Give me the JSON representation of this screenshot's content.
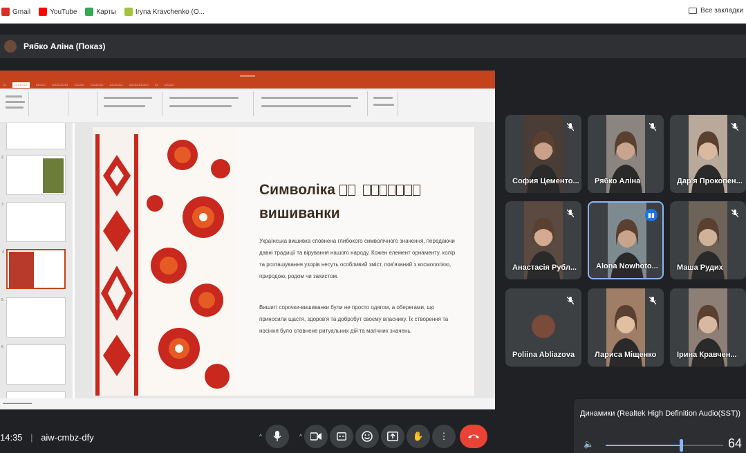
{
  "bookmarks": [
    {
      "label": "Gmail",
      "color": "#d93025"
    },
    {
      "label": "YouTube",
      "color": "#ff0000"
    },
    {
      "label": "Карты",
      "color": "#34a853"
    },
    {
      "label": "Iryna Kravchenko (О...",
      "color": "#a6c23a"
    }
  ],
  "all_bookmarks": "Все закладки",
  "presenter": "Рябко Аліна (Показ)",
  "slide": {
    "title_a": "Символіка",
    "title_b": "вишиванки",
    "para1": "Українська вишивка сповнена глибокого символічного значення, передаючи давні традиції та вірування нашого народу. Кожен елемент орнаменту, колір та розташування узорів несуть особливий зміст, пов'язаний з космологією, природою, родом чи захистом.",
    "para2": "Вишиті сорочки-вишиванки були не просто одягом, а оберегами, що приносили щастя, здоров'я та добробут своєму власнику. Їх створення та носіння було сповнене ритуальних дій та магічних значень."
  },
  "participants": [
    {
      "name": "София Цементо...",
      "muted": true,
      "bg": "#4a3d35",
      "skin": "#caa08a"
    },
    {
      "name": "Рябко Аліна",
      "muted": true,
      "bg": "#8a8580",
      "skin": "#c9a58f"
    },
    {
      "name": "Дар'я Прокопен...",
      "muted": true,
      "bg": "#b8a99a",
      "skin": "#d9b9a0"
    },
    {
      "name": "Анастасія Рубл...",
      "muted": true,
      "bg": "#5a4a42",
      "skin": "#d3ab92"
    },
    {
      "name": "Alona Nowhoto...",
      "muted": false,
      "bg": "#7d8a8f",
      "skin": "#c8a58a",
      "active": true
    },
    {
      "name": "Маша Рудих",
      "muted": true,
      "bg": "#6d6358",
      "skin": "#d0b29b"
    },
    {
      "name": "Poliina Abliazova",
      "muted": true,
      "bg": "#3c4043",
      "skin": "#7a4a3a"
    },
    {
      "name": "Лариса Міщенко",
      "muted": true,
      "bg": "#a07d66",
      "skin": "#e0c0a0"
    },
    {
      "name": "Ірина Кравчен...",
      "muted": false,
      "bg": "#8d7f76",
      "skin": "#d8b8a0"
    }
  ],
  "meeting": {
    "time": "14:35",
    "code": "aiw-cmbz-dfy"
  },
  "audio": {
    "label": "Динамики (Realtek High Definition Audio(SST))",
    "volume": "64",
    "volume_fraction": 0.64
  }
}
